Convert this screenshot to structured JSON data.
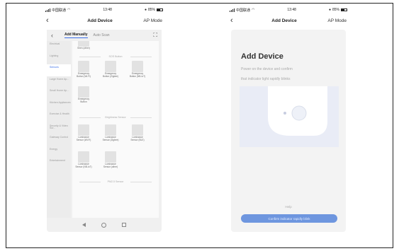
{
  "left_phone": {
    "status": {
      "carrier": "中国联通",
      "time": "13:48",
      "battery": "85%"
    },
    "nav": {
      "back": "‹",
      "title": "Add Device",
      "ap_mode": "AP Mode"
    },
    "tabs": {
      "back": "‹",
      "add_manually": "Add Manually",
      "auto_scan": "Auto Scan",
      "scan_icon": "⛶"
    },
    "categories": [
      {
        "label": "Electrical"
      },
      {
        "label": "Lighting"
      },
      {
        "label": "Sensors"
      },
      {
        "label": "Large Home Ap..."
      },
      {
        "label": "Small Home Ap..."
      },
      {
        "label": "Kitchen Appliances"
      },
      {
        "label": "Exercise & Health"
      },
      {
        "label": "Security & Video Sur..."
      },
      {
        "label": "Gateway Control"
      },
      {
        "label": "Energy"
      },
      {
        "label": "Entertainment"
      }
    ],
    "top_device": {
      "label": "Siren (other)"
    },
    "section_sos": "SOS Button",
    "sos_devices": [
      {
        "label": "Emergency Button (Wi-Fi)"
      },
      {
        "label": "Emergency Button (Zigbee)"
      },
      {
        "label": "Emergency Button (NB-IoT)"
      },
      {
        "label": "Emergency Button"
      }
    ],
    "section_brightness": "Brightness Sensor",
    "brightness_devices": [
      {
        "label": "Luminance Sensor (Wi-Fi)"
      },
      {
        "label": "Luminance Sensor (Zigbee)"
      },
      {
        "label": "Luminance Sensor (BLE)"
      },
      {
        "label": "Luminance Sensor (NB-IoT)"
      },
      {
        "label": "Luminance Sensor (other)"
      }
    ],
    "section_pm": "PM2.5 Sensor",
    "bottom_nav": {
      "back": "◁",
      "home": "○",
      "recent": "□"
    }
  },
  "right_phone": {
    "status": {
      "carrier": "中国联通",
      "time": "13:48",
      "battery": "85%"
    },
    "nav": {
      "back": "‹",
      "title": "Add Device",
      "ap_mode": "AP Mode"
    },
    "heading": "Add Device",
    "instruction_1": "Power on the device and confirm",
    "instruction_2": "that indicator light rapidly blinks",
    "help": "Help",
    "confirm_button": "Confirm indicator rapidly blink"
  }
}
